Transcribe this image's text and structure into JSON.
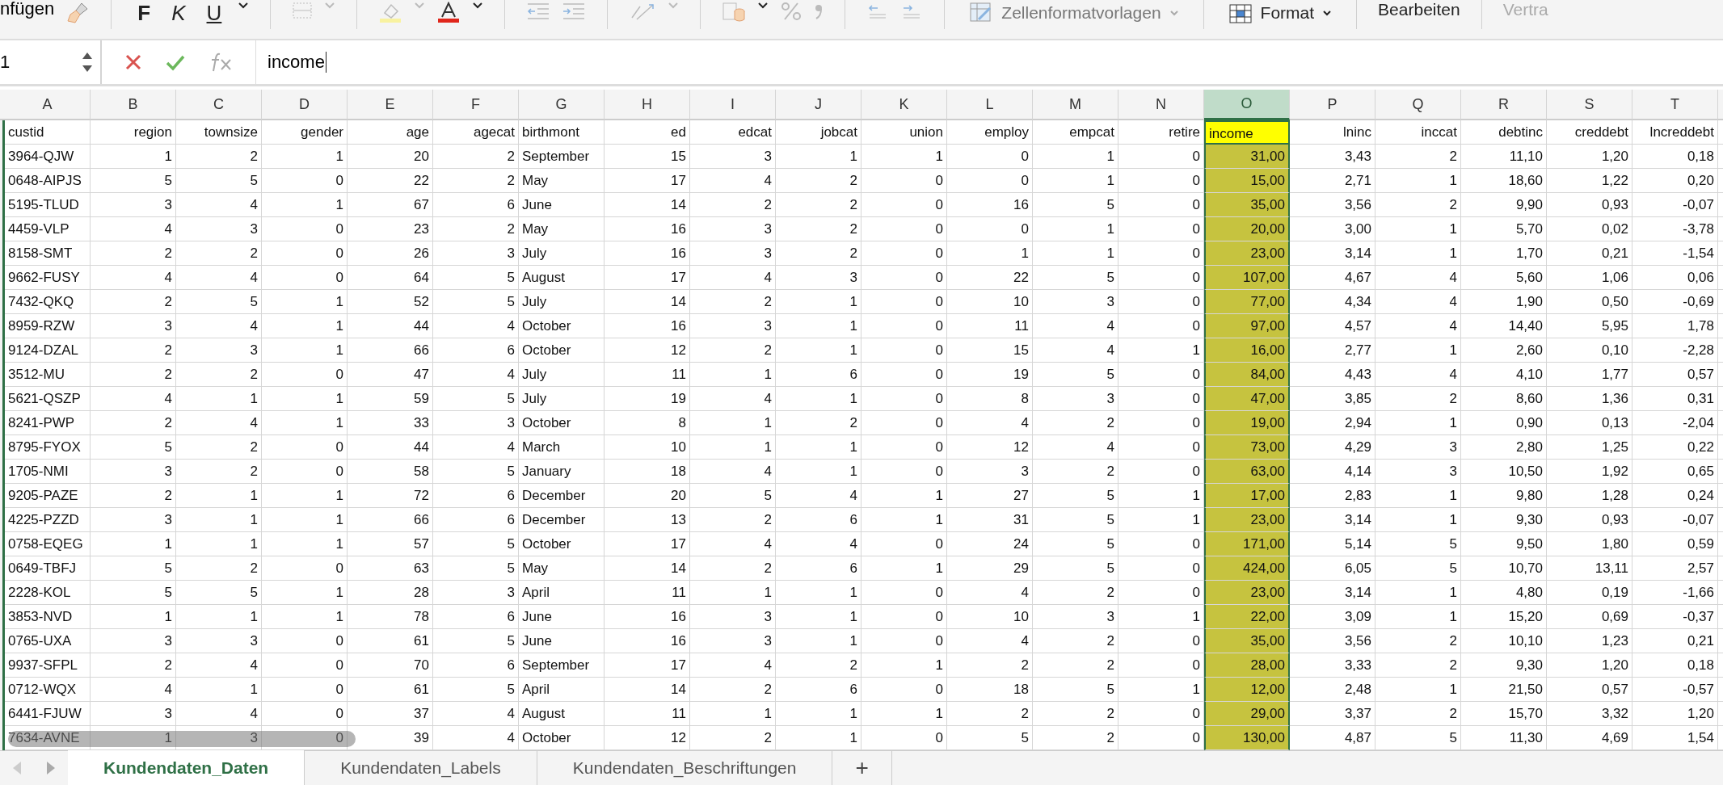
{
  "ribbon": {
    "paste_label": "nfügen",
    "bold": "F",
    "italic": "K",
    "underline": "U",
    "cell_styles": "Zellenformatvorlagen",
    "format": "Format",
    "edit": "Bearbeiten",
    "sensitivity": "Vertra"
  },
  "formula_bar": {
    "name_box": "1",
    "value": "income"
  },
  "columns": [
    {
      "letter": "A",
      "heading": "custid",
      "kind": "text",
      "selected": false
    },
    {
      "letter": "B",
      "heading": "region",
      "kind": "number",
      "selected": false
    },
    {
      "letter": "C",
      "heading": "townsize",
      "kind": "number",
      "selected": false
    },
    {
      "letter": "D",
      "heading": "gender",
      "kind": "number",
      "selected": false
    },
    {
      "letter": "E",
      "heading": "age",
      "kind": "number",
      "selected": false
    },
    {
      "letter": "F",
      "heading": "agecat",
      "kind": "number",
      "selected": false
    },
    {
      "letter": "G",
      "heading": "birthmont",
      "kind": "text",
      "selected": false
    },
    {
      "letter": "H",
      "heading": "ed",
      "kind": "number",
      "selected": false
    },
    {
      "letter": "I",
      "heading": "edcat",
      "kind": "number",
      "selected": false
    },
    {
      "letter": "J",
      "heading": "jobcat",
      "kind": "number",
      "selected": false
    },
    {
      "letter": "K",
      "heading": "union",
      "kind": "number",
      "selected": false
    },
    {
      "letter": "L",
      "heading": "employ",
      "kind": "number",
      "selected": false
    },
    {
      "letter": "M",
      "heading": "empcat",
      "kind": "number",
      "selected": false
    },
    {
      "letter": "N",
      "heading": "retire",
      "kind": "number",
      "selected": false
    },
    {
      "letter": "O",
      "heading": "income",
      "kind": "number",
      "selected": true
    },
    {
      "letter": "P",
      "heading": "lninc",
      "kind": "number",
      "selected": false
    },
    {
      "letter": "Q",
      "heading": "inccat",
      "kind": "number",
      "selected": false
    },
    {
      "letter": "R",
      "heading": "debtinc",
      "kind": "number",
      "selected": false
    },
    {
      "letter": "S",
      "heading": "creddebt",
      "kind": "number",
      "selected": false
    },
    {
      "letter": "T",
      "heading": "lncreddebt",
      "kind": "number",
      "selected": false
    }
  ],
  "rows": [
    [
      "3964-QJW",
      "1",
      "2",
      "1",
      "20",
      "2",
      "September",
      "15",
      "3",
      "1",
      "1",
      "0",
      "1",
      "0",
      "31,00",
      "3,43",
      "2",
      "11,10",
      "1,20",
      "0,18"
    ],
    [
      "0648-AIPJS",
      "5",
      "5",
      "0",
      "22",
      "2",
      "May",
      "17",
      "4",
      "2",
      "0",
      "0",
      "1",
      "0",
      "15,00",
      "2,71",
      "1",
      "18,60",
      "1,22",
      "0,20"
    ],
    [
      "5195-TLUD",
      "3",
      "4",
      "1",
      "67",
      "6",
      "June",
      "14",
      "2",
      "2",
      "0",
      "16",
      "5",
      "0",
      "35,00",
      "3,56",
      "2",
      "9,90",
      "0,93",
      "-0,07"
    ],
    [
      "4459-VLP",
      "4",
      "3",
      "0",
      "23",
      "2",
      "May",
      "16",
      "3",
      "2",
      "0",
      "0",
      "1",
      "0",
      "20,00",
      "3,00",
      "1",
      "5,70",
      "0,02",
      "-3,78"
    ],
    [
      "8158-SMT",
      "2",
      "2",
      "0",
      "26",
      "3",
      "July",
      "16",
      "3",
      "2",
      "0",
      "1",
      "1",
      "0",
      "23,00",
      "3,14",
      "1",
      "1,70",
      "0,21",
      "-1,54"
    ],
    [
      "9662-FUSY",
      "4",
      "4",
      "0",
      "64",
      "5",
      "August",
      "17",
      "4",
      "3",
      "0",
      "22",
      "5",
      "0",
      "107,00",
      "4,67",
      "4",
      "5,60",
      "1,06",
      "0,06"
    ],
    [
      "7432-QKQ",
      "2",
      "5",
      "1",
      "52",
      "5",
      "July",
      "14",
      "2",
      "1",
      "0",
      "10",
      "3",
      "0",
      "77,00",
      "4,34",
      "4",
      "1,90",
      "0,50",
      "-0,69"
    ],
    [
      "8959-RZW",
      "3",
      "4",
      "1",
      "44",
      "4",
      "October",
      "16",
      "3",
      "1",
      "0",
      "11",
      "4",
      "0",
      "97,00",
      "4,57",
      "4",
      "14,40",
      "5,95",
      "1,78"
    ],
    [
      "9124-DZAL",
      "2",
      "3",
      "1",
      "66",
      "6",
      "October",
      "12",
      "2",
      "1",
      "0",
      "15",
      "4",
      "1",
      "16,00",
      "2,77",
      "1",
      "2,60",
      "0,10",
      "-2,28"
    ],
    [
      "3512-MU",
      "2",
      "2",
      "0",
      "47",
      "4",
      "July",
      "11",
      "1",
      "6",
      "0",
      "19",
      "5",
      "0",
      "84,00",
      "4,43",
      "4",
      "4,10",
      "1,77",
      "0,57"
    ],
    [
      "5621-QSZP",
      "4",
      "1",
      "1",
      "59",
      "5",
      "July",
      "19",
      "4",
      "1",
      "0",
      "8",
      "3",
      "0",
      "47,00",
      "3,85",
      "2",
      "8,60",
      "1,36",
      "0,31"
    ],
    [
      "8241-PWP",
      "2",
      "4",
      "1",
      "33",
      "3",
      "October",
      "8",
      "1",
      "2",
      "0",
      "4",
      "2",
      "0",
      "19,00",
      "2,94",
      "1",
      "0,90",
      "0,13",
      "-2,04"
    ],
    [
      "8795-FYOX",
      "5",
      "2",
      "0",
      "44",
      "4",
      "March",
      "10",
      "1",
      "1",
      "0",
      "12",
      "4",
      "0",
      "73,00",
      "4,29",
      "3",
      "2,80",
      "1,25",
      "0,22"
    ],
    [
      "1705-NMI",
      "3",
      "2",
      "0",
      "58",
      "5",
      "January",
      "18",
      "4",
      "1",
      "0",
      "3",
      "2",
      "0",
      "63,00",
      "4,14",
      "3",
      "10,50",
      "1,92",
      "0,65"
    ],
    [
      "9205-PAZE",
      "2",
      "1",
      "1",
      "72",
      "6",
      "December",
      "20",
      "5",
      "4",
      "1",
      "27",
      "5",
      "1",
      "17,00",
      "2,83",
      "1",
      "9,80",
      "1,28",
      "0,24"
    ],
    [
      "4225-PZZD",
      "3",
      "1",
      "1",
      "66",
      "6",
      "December",
      "13",
      "2",
      "6",
      "1",
      "31",
      "5",
      "1",
      "23,00",
      "3,14",
      "1",
      "9,30",
      "0,93",
      "-0,07"
    ],
    [
      "0758-EQEG",
      "1",
      "1",
      "1",
      "57",
      "5",
      "October",
      "17",
      "4",
      "4",
      "0",
      "24",
      "5",
      "0",
      "171,00",
      "5,14",
      "5",
      "9,50",
      "1,80",
      "0,59"
    ],
    [
      "0649-TBFJ",
      "5",
      "2",
      "0",
      "63",
      "5",
      "May",
      "14",
      "2",
      "6",
      "1",
      "29",
      "5",
      "0",
      "424,00",
      "6,05",
      "5",
      "10,70",
      "13,11",
      "2,57"
    ],
    [
      "2228-KOL",
      "5",
      "5",
      "1",
      "28",
      "3",
      "April",
      "11",
      "1",
      "1",
      "0",
      "4",
      "2",
      "0",
      "23,00",
      "3,14",
      "1",
      "4,80",
      "0,19",
      "-1,66"
    ],
    [
      "3853-NVD",
      "1",
      "1",
      "1",
      "78",
      "6",
      "June",
      "16",
      "3",
      "1",
      "0",
      "10",
      "3",
      "1",
      "22,00",
      "3,09",
      "1",
      "15,20",
      "0,69",
      "-0,37"
    ],
    [
      "0765-UXA",
      "3",
      "3",
      "0",
      "61",
      "5",
      "June",
      "16",
      "3",
      "1",
      "0",
      "4",
      "2",
      "0",
      "35,00",
      "3,56",
      "2",
      "10,10",
      "1,23",
      "0,21"
    ],
    [
      "9937-SFPL",
      "2",
      "4",
      "0",
      "70",
      "6",
      "September",
      "17",
      "4",
      "2",
      "1",
      "2",
      "2",
      "0",
      "28,00",
      "3,33",
      "2",
      "9,30",
      "1,20",
      "0,18"
    ],
    [
      "0712-WQX",
      "4",
      "1",
      "0",
      "61",
      "5",
      "April",
      "14",
      "2",
      "6",
      "0",
      "18",
      "5",
      "1",
      "12,00",
      "2,48",
      "1",
      "21,50",
      "0,57",
      "-0,57"
    ],
    [
      "6441-FJUW",
      "3",
      "4",
      "0",
      "37",
      "4",
      "August",
      "11",
      "1",
      "1",
      "1",
      "2",
      "2",
      "0",
      "29,00",
      "3,37",
      "2",
      "15,70",
      "3,32",
      "1,20"
    ],
    [
      "7634-AVNE",
      "1",
      "3",
      "0",
      "39",
      "4",
      "October",
      "12",
      "2",
      "1",
      "0",
      "5",
      "2",
      "0",
      "130,00",
      "4,87",
      "5",
      "11,30",
      "4,69",
      "1,54"
    ]
  ],
  "sheet_tabs": [
    {
      "label": "Kundendaten_Daten",
      "selected": true
    },
    {
      "label": "Kundendaten_Labels",
      "selected": false
    },
    {
      "label": "Kundendaten_Beschriftungen",
      "selected": false
    }
  ],
  "add_sheet": "+"
}
